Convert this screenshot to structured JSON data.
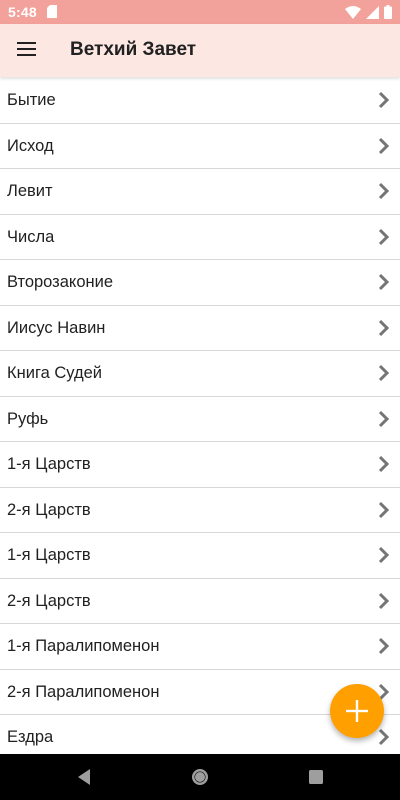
{
  "status_bar": {
    "time": "5:48",
    "icons": [
      "sd-card-icon",
      "wifi-icon",
      "signal-icon",
      "battery-icon"
    ]
  },
  "app_bar": {
    "menu_icon": "hamburger-menu-icon",
    "title": "Ветхий Завет"
  },
  "books": [
    "Бытие",
    "Исход",
    "Левит",
    "Числа",
    "Второзаконие",
    "Иисус Навин",
    "Книга Судей",
    "Руфь",
    "1-я Царств",
    "2-я Царств",
    "1-я Царств",
    "2-я Царств",
    "1-я Паралипоменон",
    "2-я Паралипоменон",
    "Ездра"
  ],
  "row_icon": "chevron-right-icon",
  "fab": {
    "icon": "plus-icon",
    "color": "#ffa000"
  },
  "nav_bar": {
    "buttons": [
      "back-icon",
      "home-icon",
      "recents-icon"
    ]
  },
  "colors": {
    "status_bar": "#f2a29a",
    "app_bar": "#fde7e3",
    "divider": "#d8d8d8",
    "chevron": "#757575",
    "text": "#212121"
  }
}
